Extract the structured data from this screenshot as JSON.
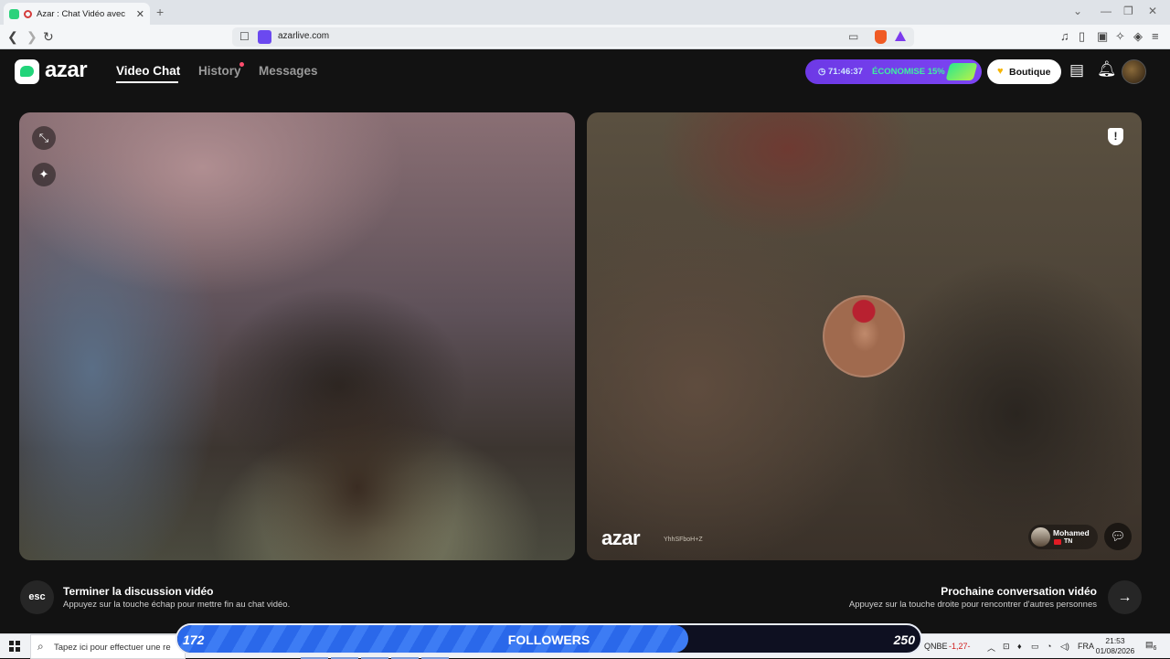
{
  "browser": {
    "tab_title": "Azar : Chat Vidéo avec de no",
    "url": "azarlive.com",
    "new_tab": "+",
    "tab_close": "✕"
  },
  "app": {
    "logo": "azar",
    "nav": [
      {
        "label": "Video Chat",
        "active": true
      },
      {
        "label": "History",
        "notification_dot": true
      },
      {
        "label": "Messages"
      }
    ],
    "promo": {
      "timer": "71:46:37",
      "label": "ÉCONOMISE 15%"
    },
    "boutique_label": "Boutique",
    "icons": [
      "store-icon",
      "bell-icon",
      "avatar"
    ]
  },
  "videos": {
    "partner": {
      "watermark": "azar",
      "watermark_id": "YhhSFboH+Z",
      "name": "Mohamed",
      "country": "TN",
      "report_symbol": "!"
    }
  },
  "hints": {
    "esc": {
      "key": "esc",
      "title": "Terminer la discussion vidéo",
      "subtitle": "Appuyez sur la touche échap pour mettre fin au chat vidéo."
    },
    "next": {
      "title": "Prochaine conversation vidéo",
      "subtitle": "Appuyez sur la touche droite pour rencontrer d'autres personnes",
      "icon": "→"
    }
  },
  "taskbar": {
    "search_placeholder": "Tapez ici pour effectuer une re",
    "weather_label": "QNBE",
    "weather_change": "-1,27-",
    "language": "FRA",
    "time": "21:53",
    "date": "01/08/2026",
    "notification_count": "6"
  },
  "followers_goal": {
    "current": "172",
    "label": "FOLLOWERS",
    "target": "250",
    "progress_fraction": 0.688
  }
}
